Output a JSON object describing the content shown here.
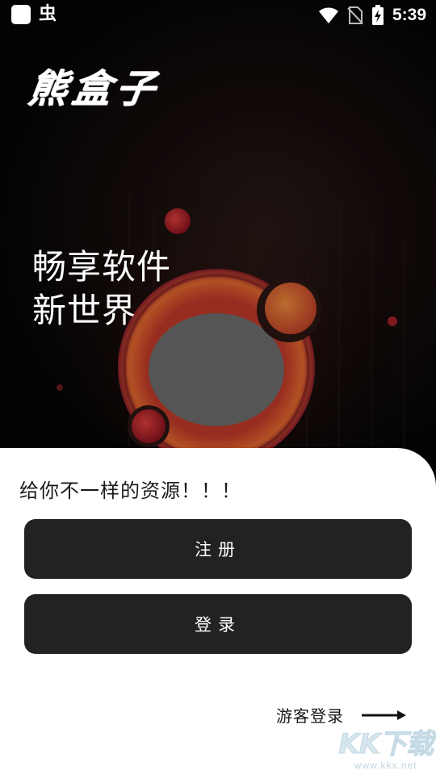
{
  "status_bar": {
    "app_icon": "square-app-icon",
    "bug_icon": "虫",
    "time": "5:39",
    "icons": [
      "wifi-icon",
      "no-sim-icon",
      "battery-charging-icon"
    ]
  },
  "hero": {
    "logo": "熊盒子",
    "slogan_line1": "畅享软件",
    "slogan_line2": "新世界"
  },
  "sheet": {
    "title": "给你不一样的资源！！！",
    "register_label": "注册",
    "login_label": "登录",
    "guest_label": "游客登录",
    "guest_icon": "arrow-right-icon"
  },
  "watermark": {
    "logo": "KK下载",
    "url": "www.kkx.net"
  },
  "colors": {
    "button_bg": "#222222",
    "sheet_bg": "#ffffff",
    "accent_orange": "#e0652c",
    "accent_red": "#b81c2c"
  }
}
